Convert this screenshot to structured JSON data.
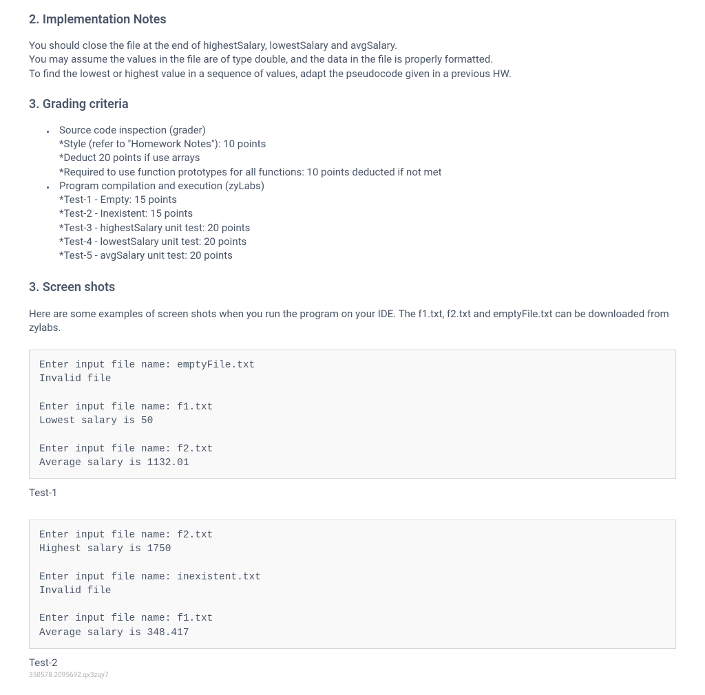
{
  "section2": {
    "heading": "2. Implementation Notes",
    "lines": [
      "You should close the file at the end of highestSalary, lowestSalary and avgSalary.",
      "You may assume the values in the file are of type double, and the data in the file is properly formatted.",
      "To find the lowest or highest value in a sequence of values, adapt the pseudocode given in a previous HW."
    ]
  },
  "section3a": {
    "heading": "3. Grading criteria",
    "items": [
      {
        "main": "Source code inspection (grader)",
        "subs": [
          "*Style (refer to \"Homework Notes\"): 10 points",
          "*Deduct 20 points if use arrays",
          "*Required to use function prototypes for all functions: 10 points deducted if not met"
        ]
      },
      {
        "main": "Program compilation and execution (zyLabs)",
        "subs": [
          "*Test-1 - Empty: 15 points",
          "*Test-2 - Inexistent: 15 points",
          "*Test-3 - highestSalary unit test: 20 points",
          "*Test-4 - lowestSalary unit test: 20 points",
          "*Test-5 - avgSalary unit test: 20 points"
        ]
      }
    ]
  },
  "section3b": {
    "heading": "3. Screen shots",
    "intro": "Here are some examples of screen shots when you run the program on your IDE. The f1.txt, f2.txt and emptyFile.txt can be downloaded from zylabs.",
    "code1": "Enter input file name: emptyFile.txt\nInvalid file\n\nEnter input file name: f1.txt\nLowest salary is 50\n\nEnter input file name: f2.txt\nAverage salary is 1132.01",
    "label1": "Test-1",
    "code2": "Enter input file name: f2.txt\nHighest salary is 1750\n\nEnter input file name: inexistent.txt\nInvalid file\n\nEnter input file name: f1.txt\nAverage salary is 348.417",
    "label2": "Test-2"
  },
  "footer": "350578.2095692.qx3zqy7"
}
